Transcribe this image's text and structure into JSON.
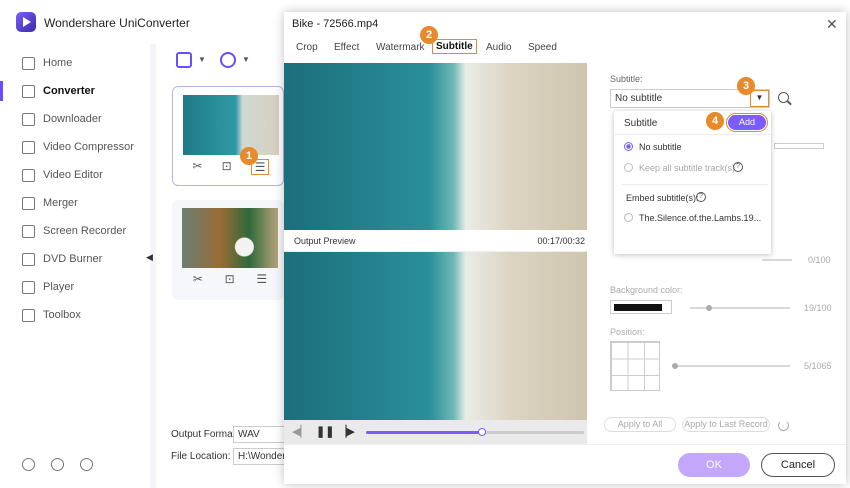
{
  "app": {
    "title": "Wondershare UniConverter"
  },
  "sidebar": {
    "items": [
      {
        "label": "Home",
        "icon": "home-icon"
      },
      {
        "label": "Converter",
        "icon": "converter-icon"
      },
      {
        "label": "Downloader",
        "icon": "download-icon"
      },
      {
        "label": "Video Compressor",
        "icon": "compress-icon"
      },
      {
        "label": "Video Editor",
        "icon": "scissors-icon"
      },
      {
        "label": "Merger",
        "icon": "merge-icon"
      },
      {
        "label": "Screen Recorder",
        "icon": "record-icon"
      },
      {
        "label": "DVD Burner",
        "icon": "disc-icon"
      },
      {
        "label": "Player",
        "icon": "play-icon"
      },
      {
        "label": "Toolbox",
        "icon": "grid-icon"
      }
    ],
    "active_index": 1
  },
  "converter": {
    "output_format_label": "Output Format:",
    "output_format_value": "WAV",
    "file_location_label": "File Location:",
    "file_location_value": "H:\\Wondersh"
  },
  "dialog": {
    "title": "Bike - 72566.mp4",
    "tabs": [
      "Crop",
      "Effect",
      "Watermark",
      "Subtitle",
      "Audio",
      "Speed"
    ],
    "active_tab": "Subtitle",
    "preview_label": "Output Preview",
    "time": "00:17/00:32",
    "playback_progress": 0.53,
    "subtitle_label": "Subtitle:",
    "subtitle_value": "No subtitle",
    "background_color_label": "Background color:",
    "position_label": "Position:",
    "values": {
      "v1": "0/100",
      "v2": "19/100",
      "v3": "5/1065"
    },
    "apply_all": "Apply to All",
    "apply_last": "Apply to Last Record",
    "ok": "OK",
    "cancel": "Cancel"
  },
  "popover": {
    "title": "Subtitle",
    "add": "Add",
    "option_no_subtitle": "No subtitle",
    "option_keep_all": "Keep all subtitle track(s)",
    "embed_label": "Embed subtitle(s):",
    "embed_file": "The.Silence.of.the.Lambs.19..."
  },
  "badges": [
    "1",
    "2",
    "3",
    "4"
  ],
  "colors": {
    "accent": "#7a5cff",
    "highlight": "#e8892a"
  }
}
